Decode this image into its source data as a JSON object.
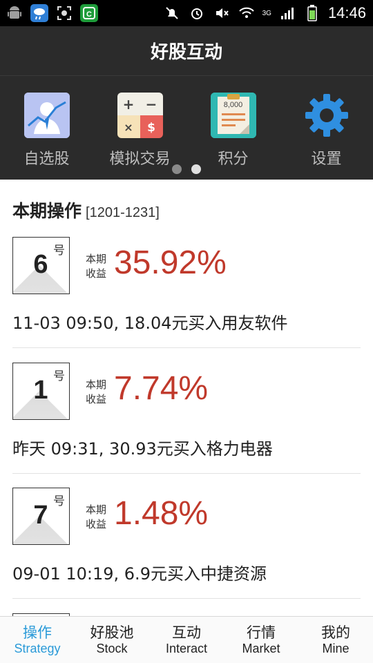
{
  "status_bar": {
    "time": "14:46",
    "network": "3G",
    "left_icons": [
      "android-icon",
      "weather-icon",
      "screenshot-icon",
      "app-c-icon"
    ],
    "right_icons": [
      "notifications-off-icon",
      "alarm-icon",
      "mute-icon",
      "wifi-icon",
      "signal-icon",
      "battery-icon"
    ]
  },
  "header": {
    "title": "好股互动"
  },
  "shortcuts": [
    {
      "label": "自选股",
      "icon": "portfolio-icon"
    },
    {
      "label": "模拟交易",
      "icon": "calculator-icon"
    },
    {
      "label": "积分",
      "icon": "points-icon",
      "icon_text": "8,000"
    },
    {
      "label": "设置",
      "icon": "gear-icon"
    }
  ],
  "pager": {
    "pages": 2,
    "active": 1
  },
  "section": {
    "title": "本期操作",
    "range": "[1201-1231]"
  },
  "cards": [
    {
      "rank": "6",
      "rank_suffix": "号",
      "yield_label": "本期收益",
      "yield": "35.92%",
      "description": "11-03 09:50, 18.04元买入用友软件"
    },
    {
      "rank": "1",
      "rank_suffix": "号",
      "yield_label": "本期收益",
      "yield": "7.74%",
      "description": "昨天 09:31, 30.93元买入格力电器"
    },
    {
      "rank": "7",
      "rank_suffix": "号",
      "yield_label": "本期收益",
      "yield": "1.48%",
      "description": "09-01 10:19, 6.9元买入中捷资源"
    }
  ],
  "bottom_nav": [
    {
      "cn": "操作",
      "en": "Strategy",
      "active": true
    },
    {
      "cn": "好股池",
      "en": "Stock",
      "active": false
    },
    {
      "cn": "互动",
      "en": "Interact",
      "active": false
    },
    {
      "cn": "行情",
      "en": "Market",
      "active": false
    },
    {
      "cn": "我的",
      "en": "Mine",
      "active": false
    }
  ],
  "colors": {
    "accent": "#2a9ad8",
    "yield": "#c0392b",
    "header_bg": "#2b2b2b"
  }
}
